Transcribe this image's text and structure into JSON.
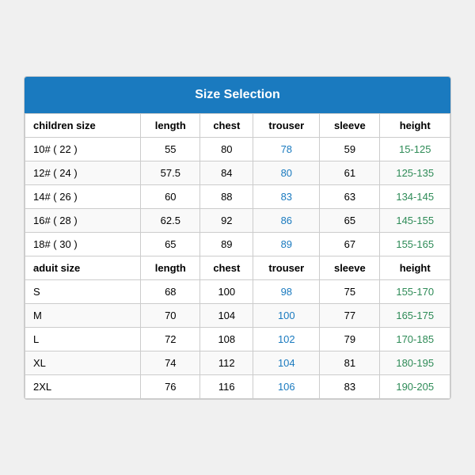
{
  "title": "Size Selection",
  "columns": [
    "children size",
    "length",
    "chest",
    "trouser",
    "sleeve",
    "height"
  ],
  "adult_columns": [
    "aduit size",
    "length",
    "chest",
    "trouser",
    "sleeve",
    "height"
  ],
  "children_rows": [
    {
      "size": "10# ( 22 )",
      "length": "55",
      "chest": "80",
      "trouser": "78",
      "sleeve": "59",
      "height": "15-125"
    },
    {
      "size": "12# ( 24 )",
      "length": "57.5",
      "chest": "84",
      "trouser": "80",
      "sleeve": "61",
      "height": "125-135"
    },
    {
      "size": "14# ( 26 )",
      "length": "60",
      "chest": "88",
      "trouser": "83",
      "sleeve": "63",
      "height": "134-145"
    },
    {
      "size": "16# ( 28 )",
      "length": "62.5",
      "chest": "92",
      "trouser": "86",
      "sleeve": "65",
      "height": "145-155"
    },
    {
      "size": "18# ( 30 )",
      "length": "65",
      "chest": "89",
      "trouser": "89",
      "sleeve": "67",
      "height": "155-165"
    }
  ],
  "adult_rows": [
    {
      "size": "S",
      "length": "68",
      "chest": "100",
      "trouser": "98",
      "sleeve": "75",
      "height": "155-170"
    },
    {
      "size": "M",
      "length": "70",
      "chest": "104",
      "trouser": "100",
      "sleeve": "77",
      "height": "165-175"
    },
    {
      "size": "L",
      "length": "72",
      "chest": "108",
      "trouser": "102",
      "sleeve": "79",
      "height": "170-185"
    },
    {
      "size": "XL",
      "length": "74",
      "chest": "112",
      "trouser": "104",
      "sleeve": "81",
      "height": "180-195"
    },
    {
      "size": "2XL",
      "length": "76",
      "chest": "116",
      "trouser": "106",
      "sleeve": "83",
      "height": "190-205"
    }
  ]
}
